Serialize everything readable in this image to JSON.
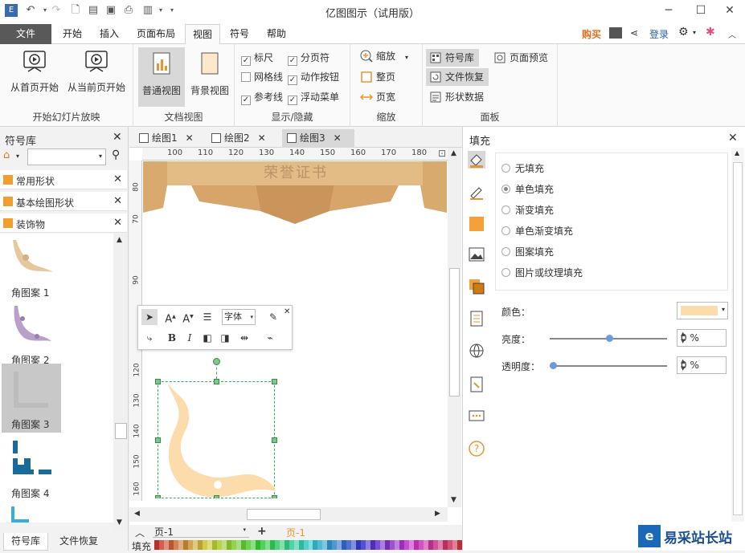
{
  "app": {
    "title": "亿图图示（试用版）"
  },
  "ribbon_tabs": {
    "file": "文件",
    "items": [
      "开始",
      "插入",
      "页面布局",
      "视图",
      "符号",
      "帮助"
    ],
    "active": "视图"
  },
  "top_right": {
    "buy": "购买",
    "login": "登录"
  },
  "ribbon": {
    "slideshow": {
      "from_first": "从首页开始",
      "from_current": "从当前页开始",
      "label": "开始幻灯片放映"
    },
    "docview": {
      "normal": "普通视图",
      "background": "背景视图",
      "label": "文档视图"
    },
    "show": {
      "ruler": "标尺",
      "page_break": "分页符",
      "grid": "网格线",
      "action_btn": "动作按钮",
      "guide": "参考线",
      "float_menu": "浮动菜单",
      "label": "显示/隐藏"
    },
    "zoom": {
      "zoom": "缩放",
      "whole_page": "整页",
      "page_width": "页宽",
      "label": "缩放"
    },
    "panel": {
      "symbol_lib": "符号库",
      "page_preview": "页面预览",
      "file_recover": "文件恢复",
      "shape_data": "形状数据",
      "label": "面板"
    }
  },
  "left_panel": {
    "title": "符号库",
    "categories": [
      "常用形状",
      "基本绘图形状",
      "装饰物"
    ],
    "symbols": [
      "角图案 1",
      "角图案 2",
      "角图案 3",
      "角图案 4"
    ],
    "bottom_tabs": [
      "符号库",
      "文件恢复"
    ]
  },
  "doc_tabs": [
    "绘图1",
    "绘图2",
    "绘图3"
  ],
  "ruler_h": [
    "100",
    "110",
    "120",
    "130",
    "140",
    "150",
    "160",
    "170",
    "180"
  ],
  "ruler_v": [
    "80",
    "70",
    "90",
    "120",
    "130",
    "140",
    "150",
    "160"
  ],
  "canvas": {
    "certificate_text": "荣誉证书"
  },
  "floating_toolbar": {
    "font_name": "字体"
  },
  "status": {
    "page_select": "页-1",
    "page_tab": "页-1",
    "fill_label": "填充"
  },
  "right_panel": {
    "title": "填充",
    "options": [
      "无填充",
      "单色填充",
      "渐变填充",
      "单色渐变填充",
      "图案填充",
      "图片或纹理填充"
    ],
    "selected_option": "单色填充",
    "color_label": "颜色：",
    "color_value": "#fbdcaa",
    "brightness_label": "亮度：",
    "brightness_value": "0 %",
    "transparency_label": "透明度：",
    "transparency_value": "0 %"
  },
  "watermark": {
    "text": "易采站长站"
  }
}
